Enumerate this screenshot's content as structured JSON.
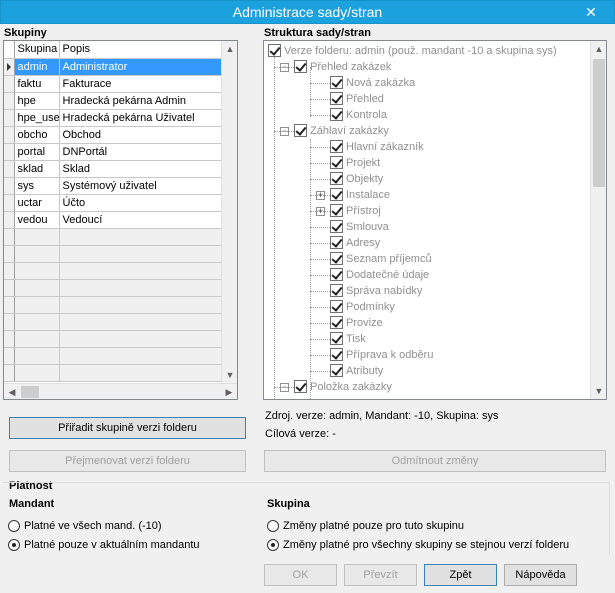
{
  "window": {
    "title": "Administrace sady/stran",
    "close_glyph": "✕"
  },
  "groups": {
    "title": "Skupiny",
    "columns": [
      "Skupina",
      "Popis"
    ],
    "rows": [
      {
        "code": "admin",
        "desc": "Administrator",
        "selected": true
      },
      {
        "code": "faktu",
        "desc": "Fakturace"
      },
      {
        "code": "hpe",
        "desc": "Hradecká pekárna Admin"
      },
      {
        "code": "hpe_use",
        "desc": "Hradecká pekárna Uživatel"
      },
      {
        "code": "obcho",
        "desc": "Obchod"
      },
      {
        "code": "portal",
        "desc": "DNPortál"
      },
      {
        "code": "sklad",
        "desc": "Sklad"
      },
      {
        "code": "sys",
        "desc": "Systémový uživatel"
      },
      {
        "code": "uctar",
        "desc": "Účto"
      },
      {
        "code": "vedou",
        "desc": "Vedoucí"
      }
    ]
  },
  "tree": {
    "title": "Struktura sady/stran",
    "nodes": [
      {
        "label": "Verze folderu: admin (použ. mandant -10 a skupina sys)",
        "level": 0,
        "expander": ""
      },
      {
        "label": "Přehled zakázek",
        "level": 1,
        "expander": "−"
      },
      {
        "label": "Nová zakázka",
        "level": 2,
        "expander": ""
      },
      {
        "label": "Přehled",
        "level": 2,
        "expander": ""
      },
      {
        "label": "Kontrola",
        "level": 2,
        "expander": ""
      },
      {
        "label": "Záhlaví zakázky",
        "level": 1,
        "expander": "−"
      },
      {
        "label": "Hlavní zákazník",
        "level": 2,
        "expander": ""
      },
      {
        "label": "Projekt",
        "level": 2,
        "expander": ""
      },
      {
        "label": "Objekty",
        "level": 2,
        "expander": ""
      },
      {
        "label": "Instalace",
        "level": 2,
        "expander": "+"
      },
      {
        "label": "Přístroj",
        "level": 2,
        "expander": "+"
      },
      {
        "label": "Smlouva",
        "level": 2,
        "expander": ""
      },
      {
        "label": "Adresy",
        "level": 2,
        "expander": ""
      },
      {
        "label": "Seznam příjemců",
        "level": 2,
        "expander": ""
      },
      {
        "label": "Dodatečné údaje",
        "level": 2,
        "expander": ""
      },
      {
        "label": "Správa nabídky",
        "level": 2,
        "expander": ""
      },
      {
        "label": "Podmínky",
        "level": 2,
        "expander": ""
      },
      {
        "label": "Provize",
        "level": 2,
        "expander": ""
      },
      {
        "label": "Tisk",
        "level": 2,
        "expander": ""
      },
      {
        "label": "Příprava k odběru",
        "level": 2,
        "expander": ""
      },
      {
        "label": "Atributy",
        "level": 2,
        "expander": ""
      },
      {
        "label": "Položka zakázky",
        "level": 1,
        "expander": "−"
      }
    ]
  },
  "buttons": {
    "assign": "Přiřadit skupině verzi folderu",
    "rename": "Přejmenovat verzi folderu",
    "reject": "Odmítnout změny",
    "ok": "OK",
    "browse": "Převzít",
    "back": "Zpět",
    "help": "Nápověda"
  },
  "info": {
    "source": "Zdroj. verze: admin, Mandant: -10, Skupina: sys",
    "target": "Cílová verze: -"
  },
  "validity": {
    "title": "Platnost",
    "mandant": {
      "title": "Mandant",
      "options": [
        "Platné ve všech mand. (-10)",
        "Platné pouze v aktuálním mandantu"
      ],
      "selected": 1
    },
    "group": {
      "title": "Skupina",
      "options": [
        "Změny platné pouze pro tuto skupinu",
        "Změny platné pro všechny skupiny  se stejnou verzí folderu"
      ],
      "selected": 1
    }
  }
}
